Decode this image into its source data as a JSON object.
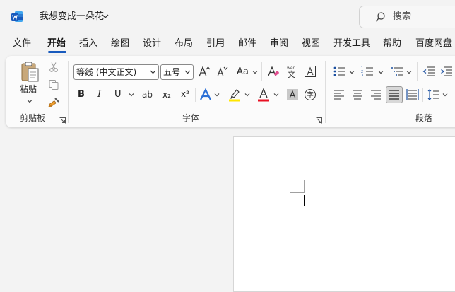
{
  "title_bar": {
    "document_title": "我想变成一朵花",
    "search_placeholder": "搜索"
  },
  "tabs": [
    {
      "label": "文件",
      "active": false
    },
    {
      "label": "开始",
      "active": true
    },
    {
      "label": "插入",
      "active": false
    },
    {
      "label": "绘图",
      "active": false
    },
    {
      "label": "设计",
      "active": false
    },
    {
      "label": "布局",
      "active": false
    },
    {
      "label": "引用",
      "active": false
    },
    {
      "label": "邮件",
      "active": false
    },
    {
      "label": "审阅",
      "active": false
    },
    {
      "label": "视图",
      "active": false
    },
    {
      "label": "开发工具",
      "active": false
    },
    {
      "label": "帮助",
      "active": false
    },
    {
      "label": "百度网盘",
      "active": false
    }
  ],
  "ribbon": {
    "clipboard": {
      "group_label": "剪贴板",
      "paste_label": "粘贴"
    },
    "font": {
      "group_label": "字体",
      "font_name": "等线 (中文正文)",
      "font_size": "五号",
      "change_case_label": "Aa",
      "bold_label": "B",
      "italic_label": "I",
      "underline_label": "U",
      "strikethrough_label": "ab",
      "subscript_label": "x₂",
      "superscript_label": "x²",
      "grow_font_label": "A^",
      "shrink_font_label": "Aˇ",
      "phonetic_label": "文",
      "enclose_label": "字",
      "highlight_color": "#ffe600",
      "font_color": "#e81123"
    },
    "paragraph": {
      "group_label": "段落"
    }
  },
  "colors": {
    "accent": "#185abd",
    "word_brand": "#185abd",
    "ribbon_bg": "#fbfbfb",
    "window_bg": "#f3f3f3"
  },
  "icons": [
    "word-logo-icon",
    "chevron-down-icon",
    "search-icon",
    "paste-icon",
    "cut-icon",
    "copy-icon",
    "format-painter-icon",
    "clear-formatting-icon",
    "phonetic-guide-icon",
    "character-border-icon",
    "text-effects-icon",
    "highlight-icon",
    "font-color-icon",
    "character-shading-icon",
    "enclose-characters-icon",
    "bullets-icon",
    "numbering-icon",
    "multilevel-list-icon",
    "decrease-indent-icon",
    "increase-indent-icon",
    "align-left-icon",
    "align-center-icon",
    "align-right-icon",
    "justify-icon",
    "distributed-icon",
    "line-spacing-icon",
    "dialog-launcher-icon"
  ]
}
